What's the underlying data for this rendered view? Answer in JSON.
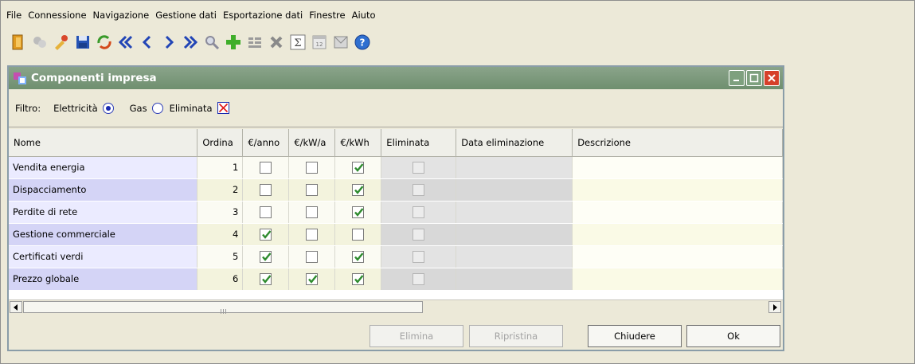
{
  "menu": [
    "File",
    "Connessione",
    "Navigazione",
    "Gestione dati",
    "Esportazione dati",
    "Finestre",
    "Aiuto"
  ],
  "toolbar_icons": [
    "exit-icon",
    "refresh-data-icon",
    "tools-icon",
    "save-icon",
    "recycle-icon",
    "first-record-icon",
    "previous-record-icon",
    "next-record-icon",
    "last-record-icon",
    "search-icon",
    "add-icon",
    "insert-rows-icon",
    "delete-icon",
    "sum-icon",
    "calendar-icon",
    "envelope-icon",
    "help-icon"
  ],
  "window": {
    "title": "Componenti impresa"
  },
  "filter": {
    "label": "Filtro:",
    "options": [
      {
        "label": "Elettricità",
        "selected": true
      },
      {
        "label": "Gas",
        "selected": false
      }
    ],
    "eliminated_label": "Eliminata"
  },
  "table": {
    "headers": [
      "Nome",
      "Ordina",
      "€/anno",
      "€/kW/a",
      "€/kWh",
      "Eliminata",
      "Data eliminazione",
      "Descrizione"
    ],
    "rows": [
      {
        "name": "Vendita energia",
        "ord": "1",
        "anno": false,
        "kwa": false,
        "kwh": true,
        "elim": false,
        "date": "",
        "desc": ""
      },
      {
        "name": "Dispacciamento",
        "ord": "2",
        "anno": false,
        "kwa": false,
        "kwh": true,
        "elim": false,
        "date": "",
        "desc": ""
      },
      {
        "name": "Perdite di rete",
        "ord": "3",
        "anno": false,
        "kwa": false,
        "kwh": true,
        "elim": false,
        "date": "",
        "desc": ""
      },
      {
        "name": "Gestione commerciale",
        "ord": "4",
        "anno": true,
        "kwa": false,
        "kwh": false,
        "elim": false,
        "date": "",
        "desc": ""
      },
      {
        "name": "Certificati verdi",
        "ord": "5",
        "anno": true,
        "kwa": false,
        "kwh": true,
        "elim": false,
        "date": "",
        "desc": ""
      },
      {
        "name": "Prezzo globale",
        "ord": "6",
        "anno": true,
        "kwa": true,
        "kwh": true,
        "elim": false,
        "date": "",
        "desc": ""
      }
    ]
  },
  "buttons": {
    "elimina": "Elimina",
    "ripristina": "Ripristina",
    "chiudere": "Chiudere",
    "ok": "Ok"
  },
  "colors": {
    "titlebar": "#7a9a7a",
    "check_mark": "#2e8b2e",
    "close_button": "#d6402a"
  }
}
